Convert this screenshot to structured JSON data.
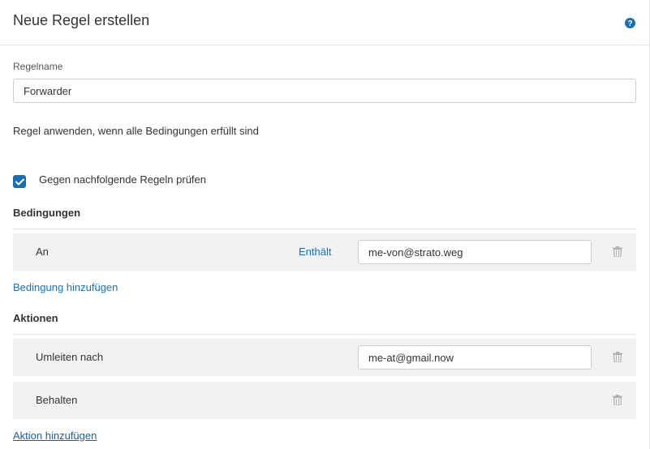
{
  "header": {
    "title": "Neue Regel erstellen",
    "help_icon": "question-circle-icon"
  },
  "rule_name": {
    "label": "Regelname",
    "value": "Forwarder"
  },
  "apply_text": "Regel anwenden, wenn alle Bedingungen erfüllt sind",
  "check_following": {
    "label": "Gegen nachfolgende Regeln prüfen",
    "checked": true
  },
  "conditions": {
    "heading": "Bedingungen",
    "rows": [
      {
        "field": "An",
        "operator": "Enthält",
        "value": "me-von@strato.weg"
      }
    ],
    "add_link": "Bedingung hinzufügen"
  },
  "actions": {
    "heading": "Aktionen",
    "rows": [
      {
        "label": "Umleiten nach",
        "value": "me-at@gmail.now"
      },
      {
        "label": "Behalten"
      }
    ],
    "add_link": "Aktion hinzufügen"
  },
  "colors": {
    "accent": "#1a6fb4",
    "row_background": "#f2f2f2",
    "divider": "#e0e0e0"
  }
}
